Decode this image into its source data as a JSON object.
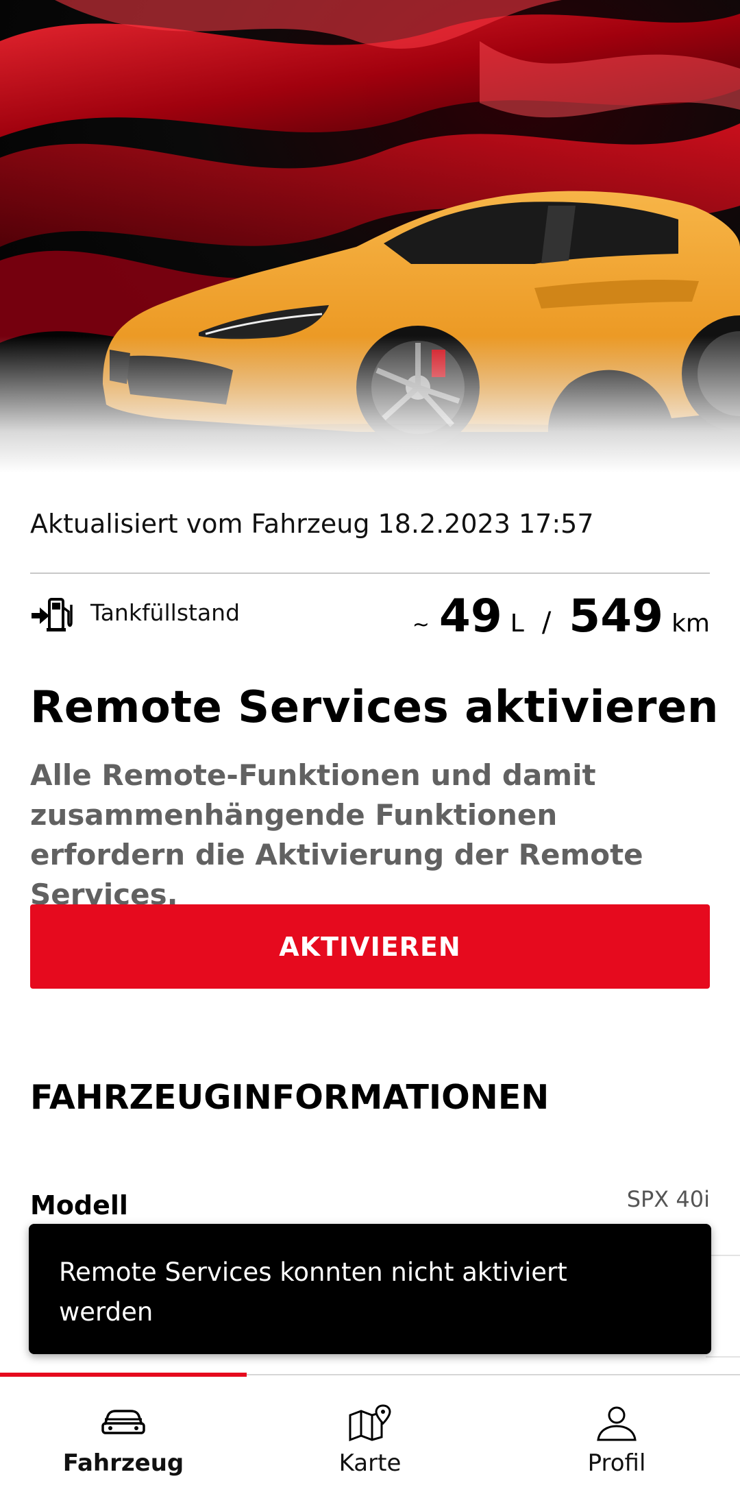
{
  "vehicle_status": {
    "updated_text": "Aktualisiert vom Fahrzeug 18.2.2023 17:57",
    "fuel_label": "Tankfüllstand",
    "approx": "~",
    "fuel_liters": "49",
    "fuel_unit": "L",
    "separator": "/",
    "range_value": "549",
    "range_unit": "km",
    "fuel_icon": "fuel-pump-icon"
  },
  "remote_services": {
    "title": "Remote Services aktivieren",
    "description": "Alle Remote-Funktionen und damit zusammenhängende Funktionen erfordern die Aktivierung der Remote Services.",
    "button_label": "AKTIVIEREN"
  },
  "vehicle_info": {
    "section_title": "FAHRZEUGINFORMATIONEN",
    "rows": [
      {
        "key": "Modell",
        "value": "SPX 40i"
      }
    ]
  },
  "toast": {
    "message": "Remote Services konnten nicht aktiviert werden"
  },
  "bottom_nav": {
    "items": [
      {
        "label": "Fahrzeug",
        "icon": "car-icon",
        "active": true
      },
      {
        "label": "Karte",
        "icon": "map-pin-icon",
        "active": false
      },
      {
        "label": "Profil",
        "icon": "person-icon",
        "active": false
      }
    ]
  },
  "colors": {
    "accent": "#e60a1e",
    "car_body": "#f0a330",
    "toast_bg": "#000000",
    "description_text": "#616161"
  }
}
